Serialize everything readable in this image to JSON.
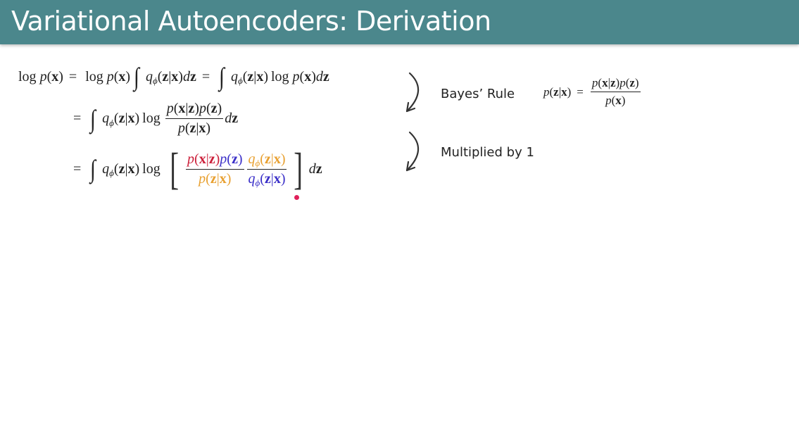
{
  "header": {
    "title": "Variational Autoencoders: Derivation",
    "color": "#4b878c"
  },
  "colors": {
    "red": "#cc1f3a",
    "blue": "#3a2fc8",
    "orange": "#e8a030"
  },
  "math": {
    "line1": [
      {
        "t": "log",
        "s": "rm fn"
      },
      {
        "t": "p",
        "s": "it"
      },
      {
        "t": "(",
        "s": "rm"
      },
      {
        "t": "x",
        "s": "bf"
      },
      {
        "t": ")",
        "s": "rm"
      },
      {
        "t": "=",
        "s": "rm op"
      },
      {
        "t": "log",
        "s": "rm fn"
      },
      {
        "t": "p",
        "s": "it"
      },
      {
        "t": "(",
        "s": "rm"
      },
      {
        "t": "x",
        "s": "bf"
      },
      {
        "t": ")",
        "s": "rm"
      },
      {
        "t": "∫",
        "s": "int"
      },
      {
        "t": "q",
        "s": "it"
      },
      {
        "t": "ϕ",
        "s": "sub"
      },
      {
        "t": "(",
        "s": "rm"
      },
      {
        "t": "z",
        "s": "bf"
      },
      {
        "t": "|",
        "s": "rm"
      },
      {
        "t": "x",
        "s": "bf"
      },
      {
        "t": ")",
        "s": "rm"
      },
      {
        "t": "d",
        "s": "it"
      },
      {
        "t": "z",
        "s": "bf"
      },
      {
        "t": "=",
        "s": "rm op"
      },
      {
        "t": "∫",
        "s": "int"
      },
      {
        "t": "q",
        "s": "it"
      },
      {
        "t": "ϕ",
        "s": "sub"
      },
      {
        "t": "(",
        "s": "rm"
      },
      {
        "t": "z",
        "s": "bf"
      },
      {
        "t": "|",
        "s": "rm"
      },
      {
        "t": "x",
        "s": "bf"
      },
      {
        "t": ")",
        "s": "rm"
      },
      {
        "t": "log",
        "s": "rm fn"
      },
      {
        "t": "p",
        "s": "it"
      },
      {
        "t": "(",
        "s": "rm"
      },
      {
        "t": "x",
        "s": "bf"
      },
      {
        "t": ")",
        "s": "rm"
      },
      {
        "t": "d",
        "s": "it"
      },
      {
        "t": "z",
        "s": "bf"
      }
    ],
    "line2": [
      {
        "t": "=",
        "s": "rm op"
      },
      {
        "t": "∫",
        "s": "int"
      },
      {
        "t": "q",
        "s": "it"
      },
      {
        "t": "ϕ",
        "s": "sub"
      },
      {
        "t": "(",
        "s": "rm"
      },
      {
        "t": "z",
        "s": "bf"
      },
      {
        "t": "|",
        "s": "rm"
      },
      {
        "t": "x",
        "s": "bf"
      },
      {
        "t": ")",
        "s": "rm"
      },
      {
        "t": "log",
        "s": "rm fn"
      },
      {
        "frac": true,
        "num": [
          {
            "t": "p",
            "s": "it"
          },
          {
            "t": "(",
            "s": "rm"
          },
          {
            "t": "x",
            "s": "bf"
          },
          {
            "t": "|",
            "s": "rm"
          },
          {
            "t": "z",
            "s": "bf"
          },
          {
            "t": ")",
            "s": "rm"
          },
          {
            "t": "p",
            "s": "it"
          },
          {
            "t": "(",
            "s": "rm"
          },
          {
            "t": "z",
            "s": "bf"
          },
          {
            "t": ")",
            "s": "rm"
          }
        ],
        "den": [
          {
            "t": "p",
            "s": "it"
          },
          {
            "t": "(",
            "s": "rm"
          },
          {
            "t": "z",
            "s": "bf"
          },
          {
            "t": "|",
            "s": "rm"
          },
          {
            "t": "x",
            "s": "bf"
          },
          {
            "t": ")",
            "s": "rm"
          }
        ]
      },
      {
        "t": "d",
        "s": "it"
      },
      {
        "t": "z",
        "s": "bf"
      }
    ],
    "line3": [
      {
        "t": "=",
        "s": "rm op"
      },
      {
        "t": "∫",
        "s": "int"
      },
      {
        "t": "q",
        "s": "it"
      },
      {
        "t": "ϕ",
        "s": "sub"
      },
      {
        "t": "(",
        "s": "rm"
      },
      {
        "t": "z",
        "s": "bf"
      },
      {
        "t": "|",
        "s": "rm"
      },
      {
        "t": "x",
        "s": "bf"
      },
      {
        "t": ")",
        "s": "rm"
      },
      {
        "t": "log",
        "s": "rm fn"
      },
      {
        "t": "[",
        "s": "bracket"
      },
      {
        "frac": true,
        "num": [
          {
            "t": "p",
            "s": "it",
            "c": "red"
          },
          {
            "t": "(",
            "s": "rm",
            "c": "red"
          },
          {
            "t": "x",
            "s": "bf",
            "c": "red"
          },
          {
            "t": "|",
            "s": "rm",
            "c": "red"
          },
          {
            "t": "z",
            "s": "bf",
            "c": "red"
          },
          {
            "t": ")",
            "s": "rm",
            "c": "red"
          },
          {
            "t": "p",
            "s": "it",
            "c": "blue"
          },
          {
            "t": "(",
            "s": "rm",
            "c": "blue"
          },
          {
            "t": "z",
            "s": "bf",
            "c": "blue"
          },
          {
            "t": ")",
            "s": "rm",
            "c": "blue"
          }
        ],
        "den": [
          {
            "t": "p",
            "s": "it",
            "c": "orange"
          },
          {
            "t": "(",
            "s": "rm",
            "c": "orange"
          },
          {
            "t": "z",
            "s": "bf",
            "c": "orange"
          },
          {
            "t": "|",
            "s": "rm",
            "c": "orange"
          },
          {
            "t": "x",
            "s": "bf",
            "c": "orange"
          },
          {
            "t": ")",
            "s": "rm",
            "c": "orange"
          }
        ]
      },
      {
        "frac": true,
        "num": [
          {
            "t": "q",
            "s": "it",
            "c": "orange"
          },
          {
            "t": "ϕ",
            "s": "sub",
            "c": "orange"
          },
          {
            "t": "(",
            "s": "rm",
            "c": "orange"
          },
          {
            "t": "z",
            "s": "bf",
            "c": "orange"
          },
          {
            "t": "|",
            "s": "rm",
            "c": "orange"
          },
          {
            "t": "x",
            "s": "bf",
            "c": "orange"
          },
          {
            "t": ")",
            "s": "rm",
            "c": "orange"
          }
        ],
        "den": [
          {
            "t": "q",
            "s": "it",
            "c": "blue"
          },
          {
            "t": "ϕ",
            "s": "sub",
            "c": "blue"
          },
          {
            "t": "(",
            "s": "rm",
            "c": "blue"
          },
          {
            "t": "z",
            "s": "bf",
            "c": "blue"
          },
          {
            "t": "|",
            "s": "rm",
            "c": "blue"
          },
          {
            "t": "x",
            "s": "bf",
            "c": "blue"
          },
          {
            "t": ")",
            "s": "rm",
            "c": "blue"
          }
        ]
      },
      {
        "t": "]",
        "s": "bracket"
      },
      {
        "t": "d",
        "s": "it"
      },
      {
        "t": "z",
        "s": "bf"
      }
    ],
    "bayes": [
      {
        "t": "p",
        "s": "it"
      },
      {
        "t": "(",
        "s": "rm"
      },
      {
        "t": "z",
        "s": "bf"
      },
      {
        "t": "|",
        "s": "rm"
      },
      {
        "t": "x",
        "s": "bf"
      },
      {
        "t": ")",
        "s": "rm"
      },
      {
        "t": "=",
        "s": "rm op"
      },
      {
        "frac": true,
        "num": [
          {
            "t": "p",
            "s": "it"
          },
          {
            "t": "(",
            "s": "rm"
          },
          {
            "t": "x",
            "s": "bf"
          },
          {
            "t": "|",
            "s": "rm"
          },
          {
            "t": "z",
            "s": "bf"
          },
          {
            "t": ")",
            "s": "rm"
          },
          {
            "t": "p",
            "s": "it"
          },
          {
            "t": "(",
            "s": "rm"
          },
          {
            "t": "z",
            "s": "bf"
          },
          {
            "t": ")",
            "s": "rm"
          }
        ],
        "den": [
          {
            "t": "p",
            "s": "it"
          },
          {
            "t": "(",
            "s": "rm"
          },
          {
            "t": "x",
            "s": "bf"
          },
          {
            "t": ")",
            "s": "rm"
          }
        ]
      }
    ]
  },
  "annotations": {
    "bayes_label": "Bayes’ Rule",
    "multiplied_label": "Multiplied by 1"
  },
  "icons": {
    "arrow": "curved-arrow-down-left",
    "pointer": "laser-pointer-dot"
  }
}
